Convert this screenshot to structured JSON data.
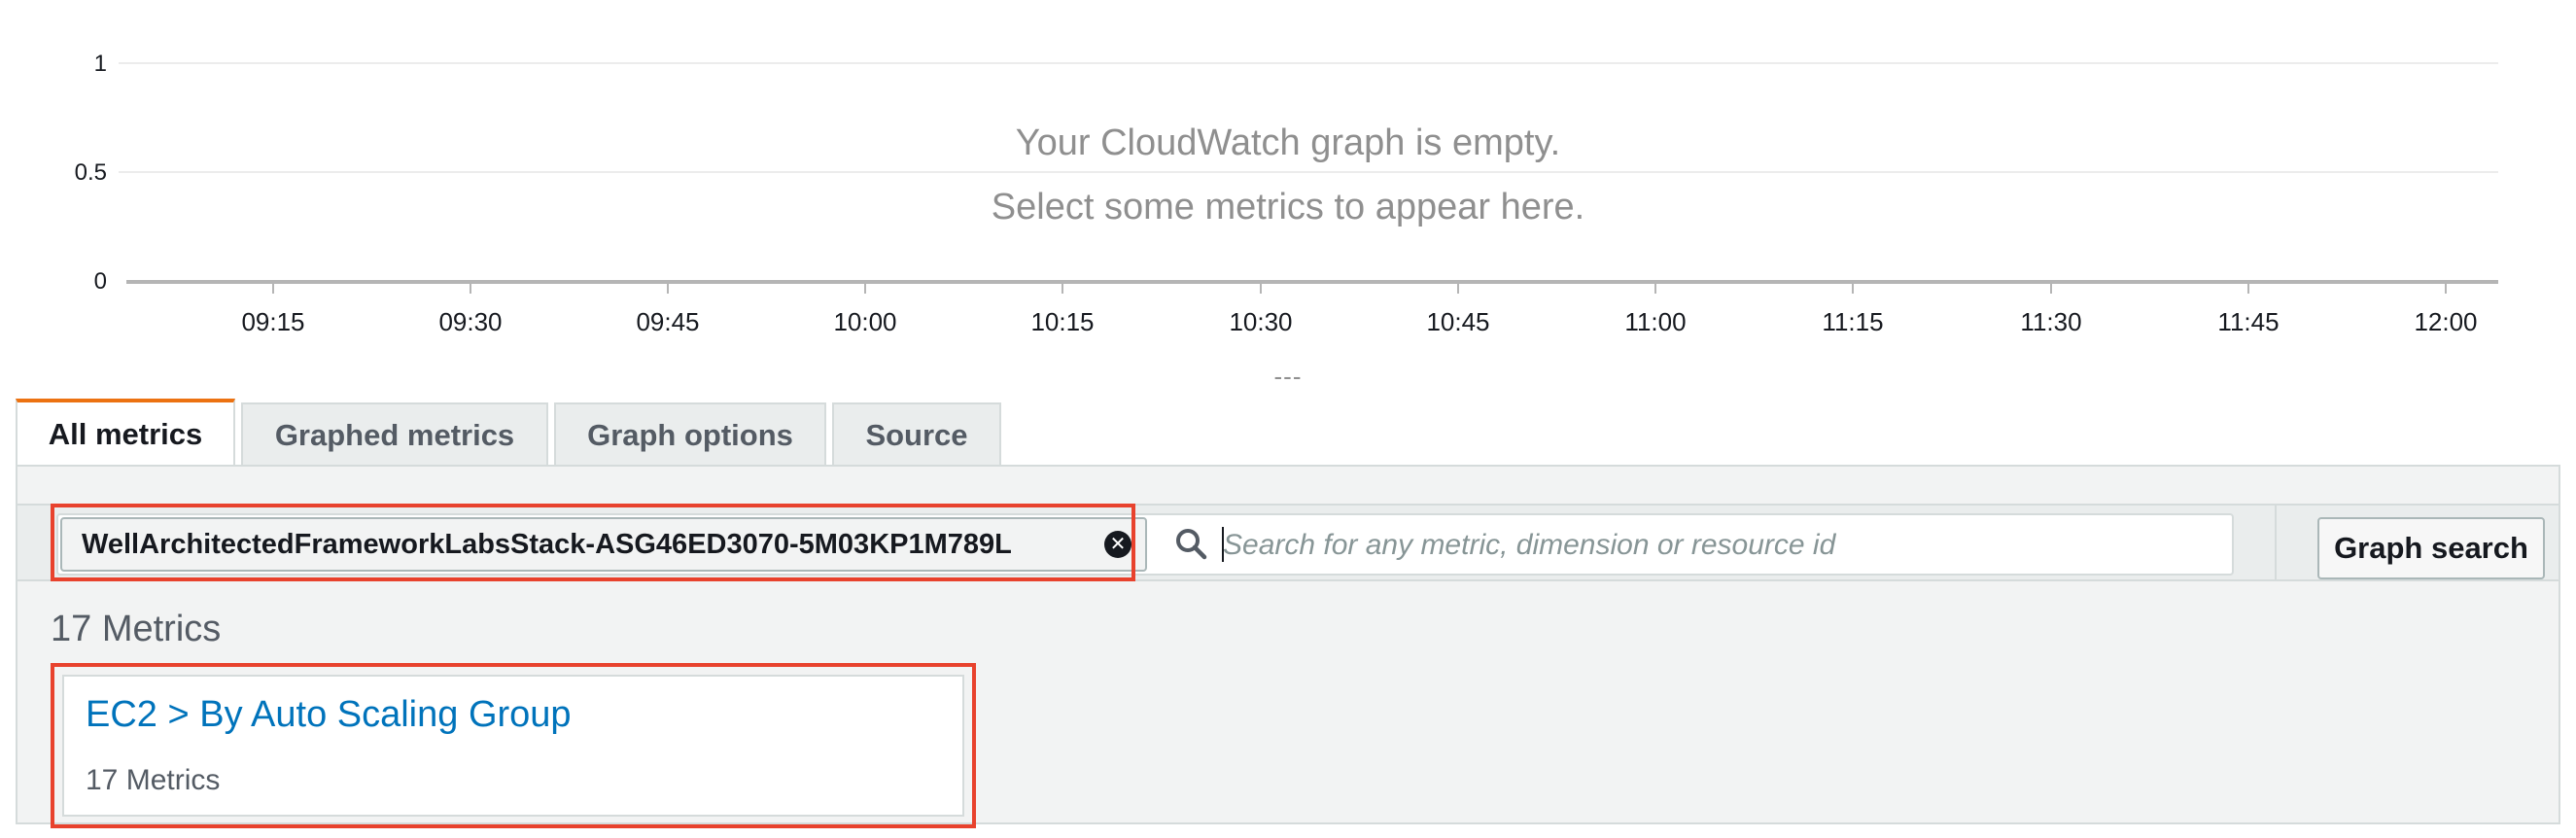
{
  "graph": {
    "y_ticks": [
      "1",
      "0.5",
      "0"
    ],
    "x_ticks": [
      "09:15",
      "09:30",
      "09:45",
      "10:00",
      "10:15",
      "10:30",
      "10:45",
      "11:00",
      "11:15",
      "11:30",
      "11:45",
      "12:00"
    ],
    "empty_title": "Your CloudWatch graph is empty.",
    "empty_subtitle": "Select some metrics to appear here.",
    "resize_handle": "---"
  },
  "tabs": [
    {
      "label": "All metrics",
      "active": true
    },
    {
      "label": "Graphed metrics",
      "active": false
    },
    {
      "label": "Graph options",
      "active": false
    },
    {
      "label": "Source",
      "active": false
    }
  ],
  "search": {
    "token": "WellArchitectedFrameworkLabsStack-ASG46ED3070-5M03KP1M789L",
    "placeholder": "Search for any metric, dimension or resource id",
    "value": "",
    "button_label": "Graph search"
  },
  "results": {
    "count_label": "17 Metrics",
    "cards": [
      {
        "title": "EC2 > By Auto Scaling Group",
        "subtitle": "17 Metrics"
      }
    ]
  },
  "colors": {
    "accent_tab": "#ec7211",
    "link": "#0073bb",
    "highlight": "#e8422d"
  },
  "icons": {
    "search": "search-icon",
    "token_remove": "close-circle-icon"
  }
}
